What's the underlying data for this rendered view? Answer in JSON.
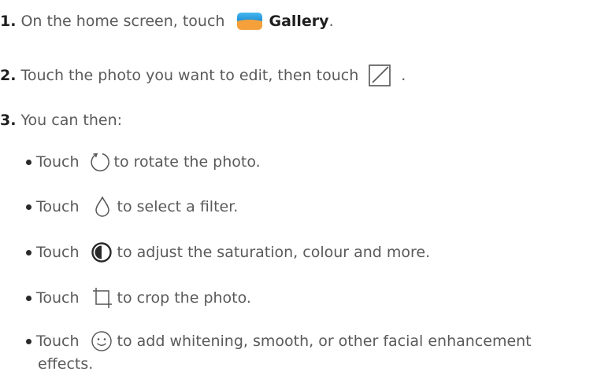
{
  "steps": [
    {
      "num": "1.",
      "pre": "On the home screen, touch",
      "app": "Gallery",
      "post": "."
    },
    {
      "num": "2.",
      "pre": "Touch the photo you want to edit, then touch",
      "post": "."
    },
    {
      "num": "3.",
      "pre": "You can then:"
    }
  ],
  "bullets": [
    {
      "touch": "Touch",
      "text": "to rotate the photo."
    },
    {
      "touch": "Touch",
      "text": "to select a filter."
    },
    {
      "touch": "Touch",
      "text": "to adjust the saturation, colour and more."
    },
    {
      "touch": "Touch",
      "text": "to crop the photo."
    },
    {
      "touch": "Touch",
      "text": "to add whitening, smooth, or other facial enhancement",
      "text2": "effects."
    }
  ],
  "icons": {
    "gallery": "gallery-app-icon",
    "edit": "edit-icon",
    "rotate": "rotate-icon",
    "filter": "filter-drop-icon",
    "adjust": "adjust-contrast-icon",
    "crop": "crop-icon",
    "beauty": "smile-icon"
  },
  "colors": {
    "gallery_top": "#3aa9e6",
    "gallery_bottom": "#f6a13c"
  }
}
